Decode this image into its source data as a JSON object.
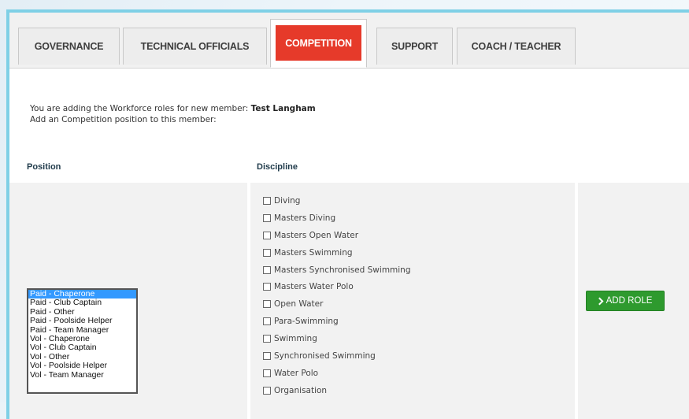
{
  "tabs": [
    {
      "label": "GOVERNANCE"
    },
    {
      "label": "TECHNICAL OFFICIALS"
    },
    {
      "label": "COMPETITION"
    },
    {
      "label": "SUPPORT"
    },
    {
      "label": "COACH / TEACHER"
    }
  ],
  "active_tab": "COMPETITION",
  "intro": {
    "line1_prefix": "You are adding the Workforce roles for new member:",
    "member_name": "Test Langham",
    "line2": "Add an Competition position to this member:"
  },
  "columns": {
    "position": "Position",
    "discipline": "Discipline"
  },
  "positions": {
    "selected": "Paid - Chaperone",
    "options": [
      "Paid - Chaperone",
      "Paid - Club Captain",
      "Paid - Other",
      "Paid - Poolside Helper",
      "Paid - Team Manager",
      "Vol - Chaperone",
      "Vol - Club Captain",
      "Vol - Other",
      "Vol - Poolside Helper",
      "Vol - Team Manager"
    ]
  },
  "disciplines": [
    "Diving",
    "Masters Diving",
    "Masters Open Water",
    "Masters Swimming",
    "Masters Synchronised Swimming",
    "Masters Water Polo",
    "Open Water",
    "Para-Swimming",
    "Swimming",
    "Synchronised Swimming",
    "Water Polo",
    "Organisation"
  ],
  "add_role_label": "ADD ROLE",
  "colors": {
    "active_tab": "#e63a2a",
    "panel_border": "#7fd0e6",
    "add_button": "#2e9a2e",
    "selected_option": "#3399ff"
  }
}
